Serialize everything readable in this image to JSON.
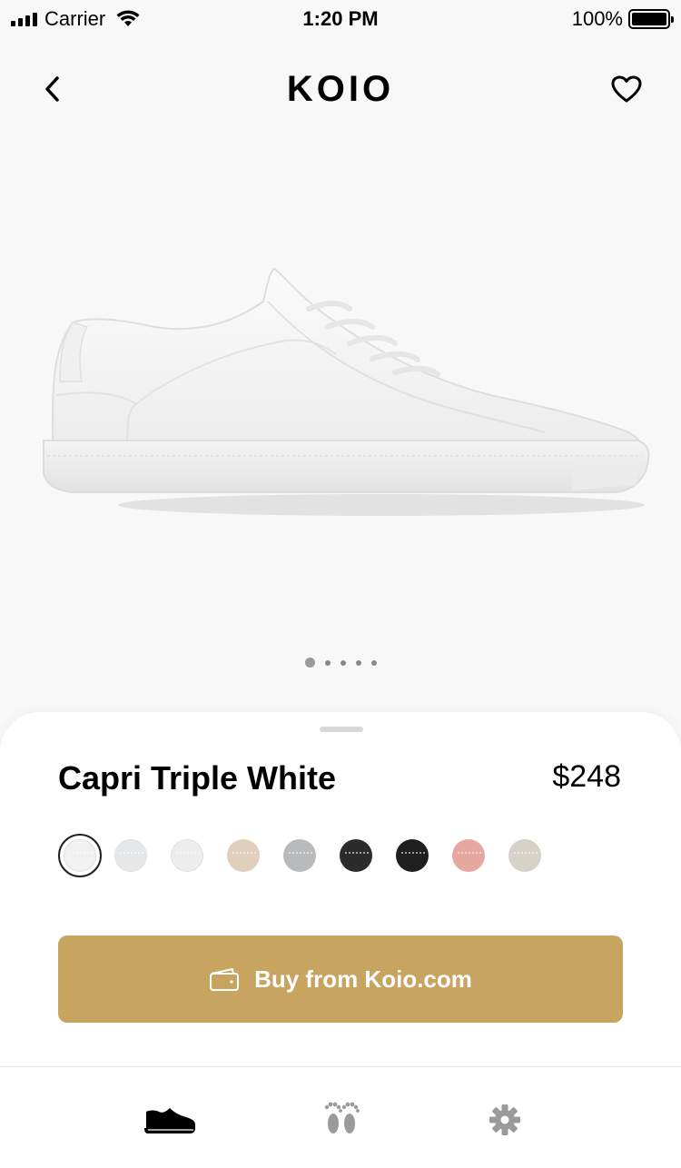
{
  "status_bar": {
    "carrier": "Carrier",
    "time": "1:20 PM",
    "battery": "100%"
  },
  "header": {
    "brand": "KOIO",
    "back_icon": "chevron-left-icon",
    "favorite_icon": "heart-outline-icon"
  },
  "product": {
    "name": "Capri Triple White",
    "price": "$248",
    "image_pages": 5,
    "active_image_page": 1,
    "color_swatches": [
      {
        "color": "#f1f1f1",
        "selected": true
      },
      {
        "color": "#e6e7e8",
        "selected": false
      },
      {
        "color": "#ededed",
        "selected": false
      },
      {
        "color": "#e0cfbb",
        "selected": false
      },
      {
        "color": "#b9babb",
        "selected": false
      },
      {
        "color": "#2b2b2b",
        "selected": false
      },
      {
        "color": "#1f1f1f",
        "selected": false
      },
      {
        "color": "#e5a79f",
        "selected": false
      },
      {
        "color": "#d6d2c8",
        "selected": false
      }
    ]
  },
  "buy_button": {
    "label": "Buy from Koio.com",
    "icon": "wallet-icon",
    "color": "#c7a560"
  },
  "tabbar": {
    "tabs": [
      {
        "icon": "sneaker-icon",
        "active": true
      },
      {
        "icon": "footprints-icon",
        "active": false
      },
      {
        "icon": "gear-icon",
        "active": false
      }
    ],
    "active_color": "#000000",
    "inactive_color": "#9b9b9b"
  }
}
